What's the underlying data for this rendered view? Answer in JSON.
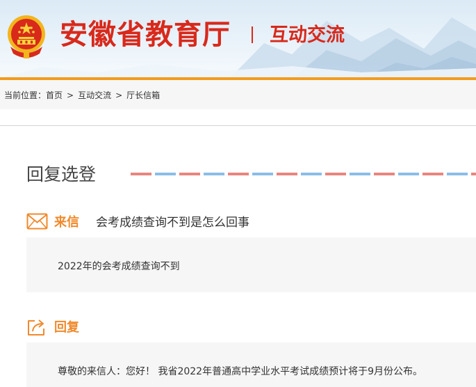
{
  "header": {
    "site_title": "安徽省教育厅",
    "section_title": "互动交流",
    "emblem_icon": "national-emblem-icon",
    "colors": {
      "title_red": "#d8291b",
      "accent_orange": "#f39a1e"
    }
  },
  "breadcrumb": {
    "prefix": "当前位置：",
    "items": [
      "首页",
      "互动交流",
      "厅长信箱"
    ],
    "separator": ">"
  },
  "main": {
    "page_title": "回复选登",
    "letter": {
      "icon": "envelope-icon",
      "label": "来信",
      "subject": "会考成绩查询不到是怎么回事",
      "body": "2022年的会考成绩查询不到"
    },
    "reply": {
      "icon": "share-reply-icon",
      "label": "回复",
      "body": "尊敬的来信人：您好！ 我省2022年普通高中学业水平考试成绩预计将于9月份公布。"
    },
    "accent_color": "#f0892b"
  }
}
